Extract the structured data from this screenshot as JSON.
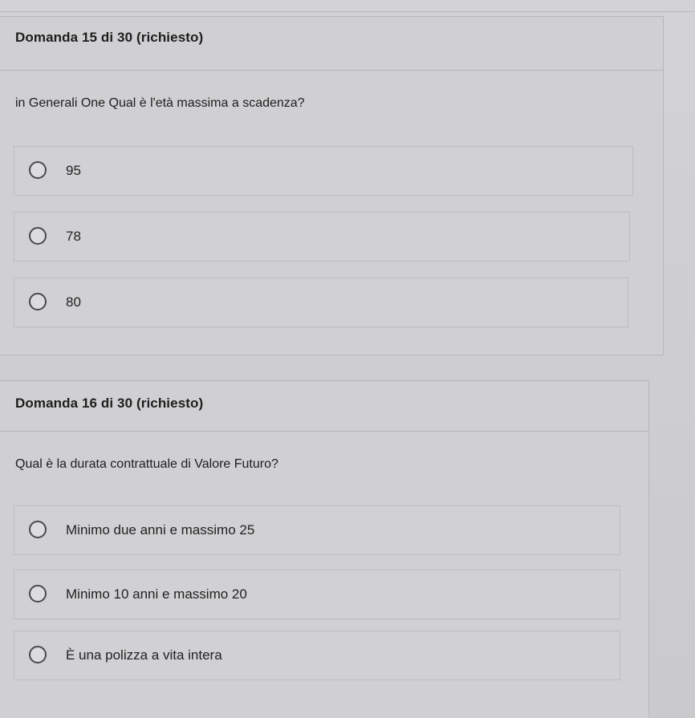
{
  "question15": {
    "title": "Domanda 15 di 30 (richiesto)",
    "text": "in Generali One Qual è l'età massima a scadenza?",
    "options": [
      {
        "label": "95"
      },
      {
        "label": "78"
      },
      {
        "label": "80"
      }
    ]
  },
  "question16": {
    "title": "Domanda 16 di 30 (richiesto)",
    "text": "Qual è la durata contrattuale di Valore Futuro?",
    "options": [
      {
        "label": "Minimo due anni e massimo 25"
      },
      {
        "label": "Minimo 10 anni e massimo 20"
      },
      {
        "label": "È una polizza a vita intera"
      }
    ]
  }
}
